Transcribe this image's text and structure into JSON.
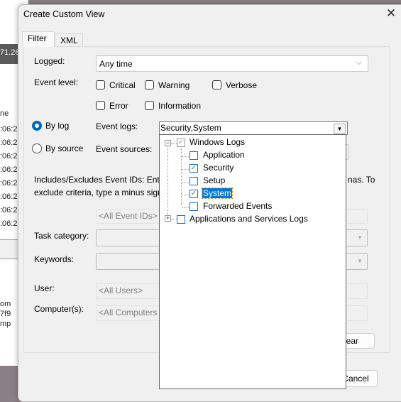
{
  "background_app": {
    "header_value": "71.26",
    "column_partial": "ne",
    "time_cells": [
      ":06:2",
      ":06:2",
      ":06:2",
      ":06:2",
      ":06:2",
      ":06:2",
      ":06:2",
      ":06:2"
    ],
    "detail_lines": [
      "om",
      "7f9",
      "mp"
    ]
  },
  "dialog": {
    "title": "Create Custom View",
    "close_icon": "close-icon",
    "tabs": [
      {
        "label": "Filter",
        "active": true
      },
      {
        "label": "XML",
        "active": false
      }
    ],
    "logged": {
      "label": "Logged:",
      "value": "Any time"
    },
    "event_level": {
      "label": "Event level:",
      "options": [
        {
          "label": "Critical",
          "checked": false
        },
        {
          "label": "Warning",
          "checked": false
        },
        {
          "label": "Verbose",
          "checked": false
        },
        {
          "label": "Error",
          "checked": false
        },
        {
          "label": "Information",
          "checked": false
        }
      ]
    },
    "by_log": {
      "label": "By log",
      "selected": true
    },
    "by_source": {
      "label": "By source",
      "selected": false
    },
    "event_logs": {
      "label": "Event logs:",
      "value": "Security,System"
    },
    "event_sources": {
      "label": "Event sources:"
    },
    "event_ids_help": {
      "line1": "Includes/Excludes Event IDs: Ente",
      "line1_end": "nas. To",
      "line2": "exclude criteria, type a minus sigr"
    },
    "event_ids": {
      "placeholder": "<All Event IDs>"
    },
    "task_category": {
      "label": "Task category:"
    },
    "keywords": {
      "label": "Keywords:"
    },
    "user": {
      "label": "User:",
      "placeholder": "<All Users>"
    },
    "computers": {
      "label": "Computer(s):",
      "placeholder": "<All Computers"
    },
    "clear_button": "lear",
    "cancel_button": "Cancel",
    "tree": [
      {
        "label": "Windows Logs",
        "checked": "partial",
        "expanded": true
      },
      {
        "label": "Application",
        "checked": false
      },
      {
        "label": "Security",
        "checked": true
      },
      {
        "label": "Setup",
        "checked": false
      },
      {
        "label": "System",
        "checked": true,
        "selected": true
      },
      {
        "label": "Forwarded Events",
        "checked": false
      },
      {
        "label": "Applications and Services Logs",
        "checked": false,
        "expanded": false
      }
    ]
  }
}
